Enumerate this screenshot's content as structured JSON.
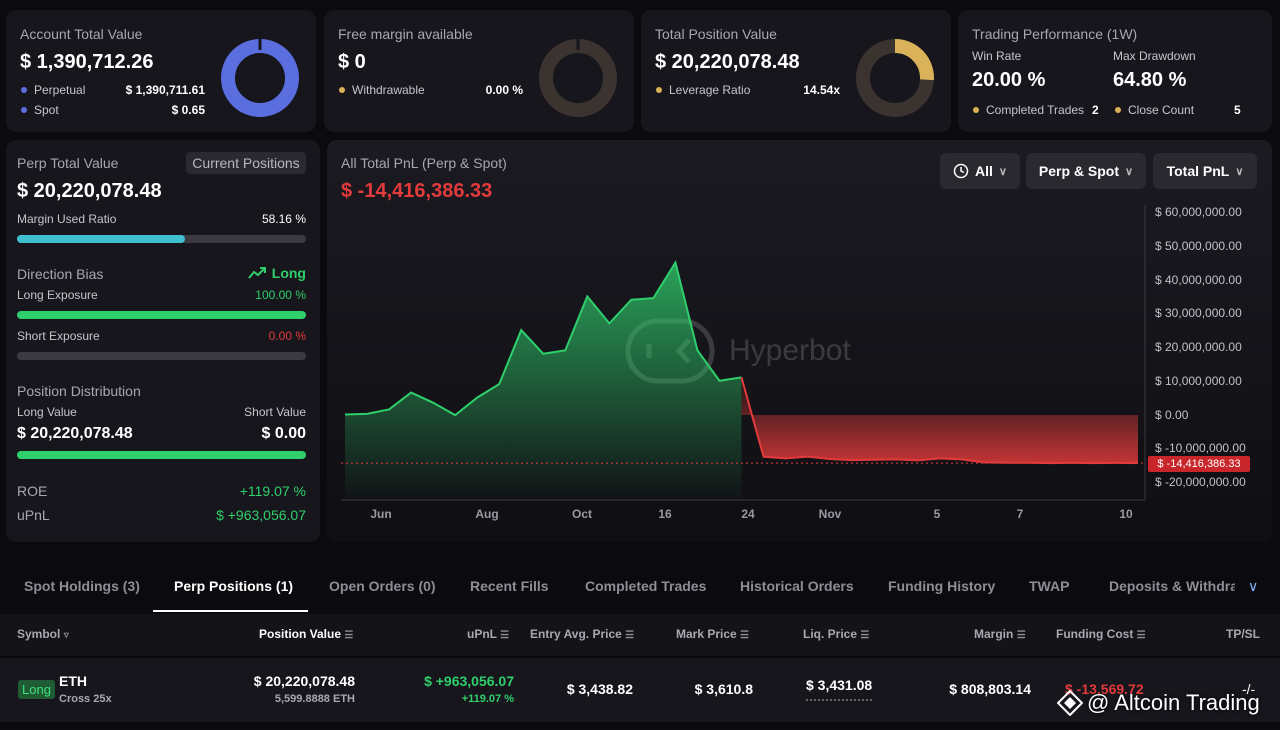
{
  "colors": {
    "perpetual": "#5a6ee0",
    "spot": "#5a6ee0",
    "gold": "#d9b25a",
    "green": "#2fcf6c",
    "red": "#e33b3b",
    "cyan": "#3fbfcf"
  },
  "top_cards": {
    "account": {
      "title": "Account Total Value",
      "value": "$ 1,390,712.26",
      "rows": [
        {
          "label": "Perpetual",
          "value": "$ 1,390,711.61"
        },
        {
          "label": "Spot",
          "value": "$ 0.65"
        }
      ]
    },
    "margin": {
      "title": "Free margin available",
      "value": "$ 0",
      "row_label": "Withdrawable",
      "row_value": "0.00 %"
    },
    "position": {
      "title": "Total Position Value",
      "value": "$ 20,220,078.48",
      "row_label": "Leverage Ratio",
      "row_value": "14.54x"
    },
    "performance": {
      "title": "Trading Performance (1W)",
      "win_rate_label": "Win Rate",
      "win_rate": "20.00 %",
      "drawdown_label": "Max Drawdown",
      "drawdown": "64.80 %",
      "completed_label": "Completed Trades",
      "completed": "2",
      "close_label": "Close Count",
      "close": "5"
    }
  },
  "left_panel": {
    "perp_title": "Perp Total Value",
    "current_positions_btn": "Current Positions",
    "perp_value": "$ 20,220,078.48",
    "margin_used_label": "Margin Used Ratio",
    "margin_used_value": "58.16 %",
    "margin_used_frac": 0.5816,
    "direction_label": "Direction Bias",
    "direction_value": "Long",
    "long_exposure_label": "Long Exposure",
    "long_exposure_value": "100.00 %",
    "long_exposure_frac": 1.0,
    "short_exposure_label": "Short Exposure",
    "short_exposure_value": "0.00 %",
    "short_exposure_frac": 0.0,
    "distribution_title": "Position Distribution",
    "long_value_label": "Long Value",
    "short_value_label": "Short Value",
    "long_value": "$ 20,220,078.48",
    "short_value": "$ 0.00",
    "roe_label": "ROE",
    "roe_value": "+119.07 %",
    "upnl_label": "uPnL",
    "upnl_value": "$ +963,056.07"
  },
  "chart_panel": {
    "title": "All Total PnL (Perp & Spot)",
    "value": "$ -14,416,386.33",
    "filters": [
      "All",
      "Perp & Spot",
      "Total PnL"
    ],
    "watermark": "Hyperbot",
    "current_label": "$ -14,416,386.33"
  },
  "chart_data": {
    "type": "area",
    "x_ticks": [
      "Jun",
      "Aug",
      "Oct",
      "16",
      "24",
      "Nov",
      "5",
      "7",
      "10"
    ],
    "y_ticks": [
      "$ 60,000,000.00",
      "$ 50,000,000.00",
      "$ 40,000,000.00",
      "$ 30,000,000.00",
      "$ 20,000,000.00",
      "$ 10,000,000.00",
      "$ 0.00",
      "$ -10,000,000.00",
      "$ -20,000,000.00"
    ],
    "ylim": [
      -20000000,
      60000000
    ],
    "series": [
      {
        "values": [
          0,
          200000,
          1500000,
          6500000,
          3500000,
          -200000,
          5000000,
          9000000,
          25000000,
          18000000,
          19000000,
          35000000,
          27000000,
          34000000,
          34500000,
          45000000,
          19000000,
          10000000,
          11000000,
          -12500000,
          -13000000,
          -12500000,
          -13200000,
          -13500000,
          -13400000,
          -13300000,
          -13600000,
          -13000000,
          -13300000,
          -14200000,
          -14300000,
          -14300000,
          -14400000,
          -14300000,
          -14400000,
          -14350000,
          -14416386
        ]
      }
    ]
  },
  "tabs": [
    "Spot Holdings (3)",
    "Perp Positions (1)",
    "Open Orders (0)",
    "Recent Fills",
    "Completed Trades",
    "Historical Orders",
    "Funding History",
    "TWAP",
    "Deposits & Withdraw"
  ],
  "table": {
    "headers": [
      "Symbol",
      "Position Value",
      "uPnL",
      "Entry Avg. Price",
      "Mark Price",
      "Liq. Price",
      "Margin",
      "Funding Cost",
      "TP/SL"
    ],
    "row": {
      "side": "Long",
      "symbol": "ETH",
      "mode": "Cross 25x",
      "position_value": "$ 20,220,078.48",
      "position_size": "5,599.8888 ETH",
      "upnl": "$ +963,056.07",
      "upnl_pct": "+119.07 %",
      "entry": "$ 3,438.82",
      "mark": "$ 3,610.8",
      "liq": "$ 3,431.08",
      "margin": "$ 808,803.14",
      "funding": "$ -13,569.72",
      "tpsl": "-/-"
    }
  },
  "overlay_watermark": "@ Altcoin Trading"
}
